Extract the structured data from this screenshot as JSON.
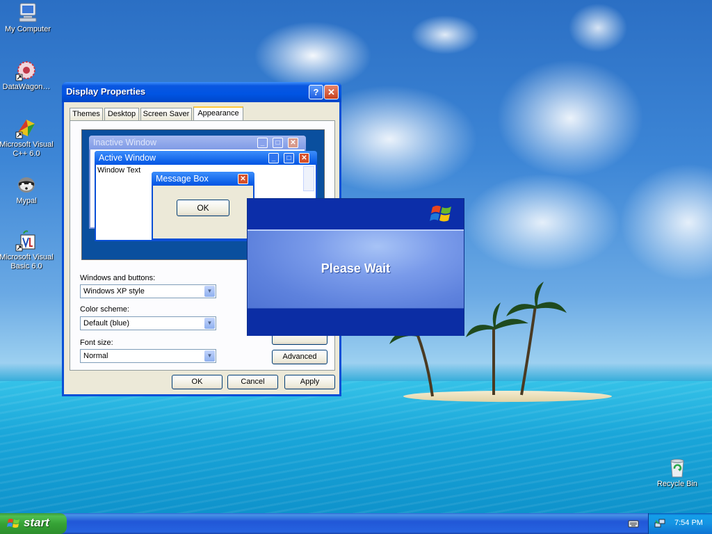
{
  "desktop": {
    "icons": [
      {
        "label": "My Computer",
        "icon": "my-computer-icon"
      },
      {
        "label": "DataWagon…",
        "icon": "datawagon-icon"
      },
      {
        "label": "Microsoft Visual C++ 6.0",
        "icon": "visual-cpp-icon"
      },
      {
        "label": "Mypal",
        "icon": "mypal-icon"
      },
      {
        "label": "Microsoft Visual Basic 6.0",
        "icon": "visual-basic-icon"
      },
      {
        "label": "Recycle Bin",
        "icon": "recycle-bin-icon"
      }
    ]
  },
  "window": {
    "title": "Display Properties",
    "tabs": [
      {
        "label": "Themes"
      },
      {
        "label": "Desktop"
      },
      {
        "label": "Screen Saver"
      },
      {
        "label": "Appearance"
      }
    ],
    "active_tab": "Appearance",
    "preview": {
      "inactive_title": "Inactive Window",
      "active_title": "Active Window",
      "window_text": "Window Text",
      "message_box_title": "Message Box",
      "message_box_ok": "OK"
    },
    "fields": {
      "windows_buttons_label": "Windows and buttons:",
      "windows_buttons_value": "Windows XP style",
      "color_scheme_label": "Color scheme:",
      "color_scheme_value": "Default (blue)",
      "font_size_label": "Font size:",
      "font_size_value": "Normal"
    },
    "advanced_label": "Advanced",
    "buttons": {
      "ok": "OK",
      "cancel": "Cancel",
      "apply": "Apply"
    }
  },
  "please_wait": {
    "message": "Please Wait"
  },
  "taskbar": {
    "start_label": "start",
    "clock": "7:54 PM"
  },
  "colors": {
    "xp_blue": "#0054e3",
    "start_green": "#36a336",
    "window_face": "#ece9d8"
  }
}
